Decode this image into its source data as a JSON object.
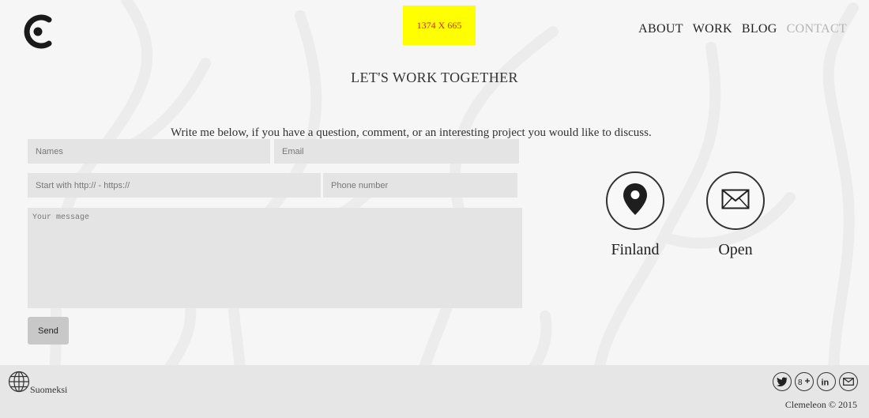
{
  "header": {
    "size_badge": "1374 X 665",
    "nav": [
      {
        "label": "ABOUT",
        "active": false
      },
      {
        "label": "WORK",
        "active": false
      },
      {
        "label": "BLOG",
        "active": false
      },
      {
        "label": "CONTACT",
        "active": true
      }
    ]
  },
  "main": {
    "title": "LET'S WORK TOGETHER",
    "intro": "Write me below, if you have a question, comment, or an interesting project you would like to discuss."
  },
  "form": {
    "names_placeholder": "Names",
    "email_placeholder": "Email",
    "website_placeholder": "Start with http:// - https://",
    "phone_placeholder": "Phone number",
    "message_placeholder": "Your message",
    "send_label": "Send"
  },
  "info": {
    "location_label": "Finland",
    "status_label": "Open"
  },
  "footer": {
    "language": "Suomeksi",
    "social_icons": [
      "twitter-icon",
      "google-plus-icon",
      "linkedin-icon",
      "email-icon"
    ],
    "copyright": "Clemeleon © 2015"
  },
  "colors": {
    "background": "#f6f6f6",
    "field_bg": "#e4e4e4",
    "badge_bg": "#ffff00",
    "badge_text": "#e1231e",
    "nav_active": "#b4b4b4",
    "footer_bg": "#e6e6e6"
  }
}
